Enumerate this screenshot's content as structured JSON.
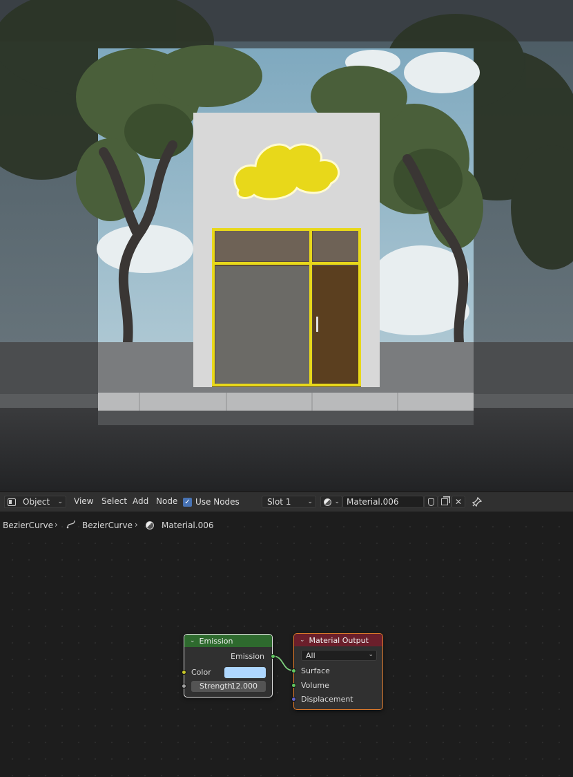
{
  "toolbar": {
    "mode": "Object",
    "menus": [
      "View",
      "Select",
      "Add",
      "Node"
    ],
    "use_nodes_label": "Use Nodes",
    "use_nodes_checked": true,
    "slot": "Slot 1",
    "material_name": "Material.006"
  },
  "breadcrumb": {
    "items": [
      "BezierCurve",
      "BezierCurve",
      "Material.006"
    ]
  },
  "nodes": {
    "emission": {
      "title": "Emission",
      "output_label": "Emission",
      "color_label": "Color",
      "color_value": "#aed7ff",
      "strength_label": "Strength",
      "strength_value": "12.000",
      "header_color": "#2e6a2e"
    },
    "material_output": {
      "title": "Material Output",
      "target": "All",
      "inputs": [
        "Surface",
        "Volume",
        "Displacement"
      ],
      "header_color": "#6b1f2b"
    }
  },
  "colors": {
    "socket_shader": "#63c763",
    "socket_color": "#c7c729",
    "socket_float": "#a1a1a1",
    "socket_vector": "#6363c7",
    "sign_yellow": "#e8d81a"
  },
  "icons": {
    "editor_type": "node-editor-icon",
    "material": "material-sphere-icon",
    "curve": "curve-icon",
    "pin": "pin-icon"
  }
}
